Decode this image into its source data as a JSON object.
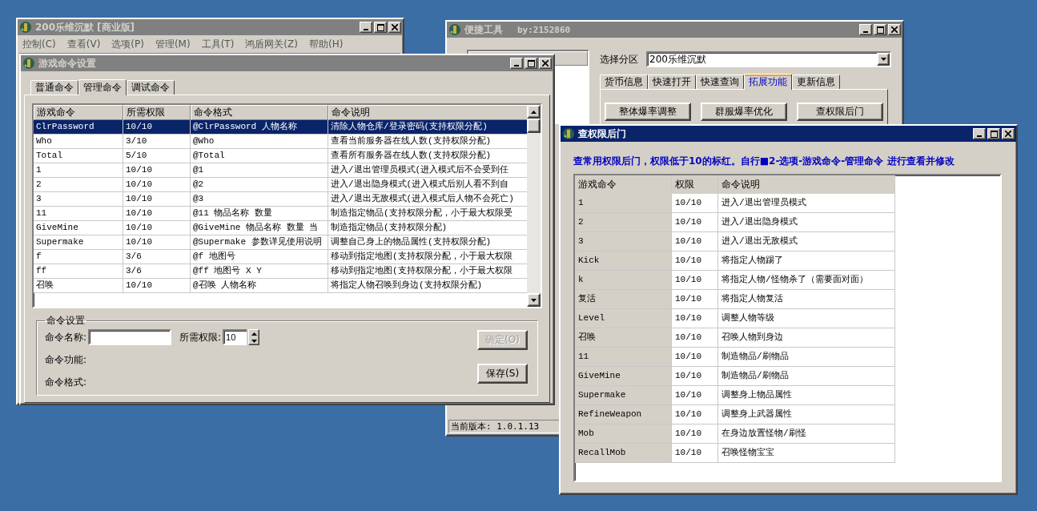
{
  "main_window": {
    "title": "200乐维沉默",
    "edition": "[商业版]",
    "active": false,
    "menu": [
      "控制(C)",
      "查看(V)",
      "选项(P)",
      "管理(M)",
      "工具(T)",
      "鸿盾网关(Z)",
      "帮助(H)"
    ]
  },
  "command_window": {
    "title": "游戏命令设置",
    "active": false,
    "tabs": [
      {
        "label": "普通命令",
        "selected": false
      },
      {
        "label": "管理命令",
        "selected": true
      },
      {
        "label": "调试命令",
        "selected": false
      }
    ],
    "columns": [
      "游戏命令",
      "所需权限",
      "命令格式",
      "命令说明"
    ],
    "rows": [
      {
        "cells": [
          "ClrPassword",
          "10/10",
          "@ClrPassword 人物名称",
          "清除人物仓库/登录密码(支持权限分配)"
        ],
        "selected": true
      },
      {
        "cells": [
          "Who",
          "3/10",
          "@Who",
          "查看当前服务器在线人数(支持权限分配)"
        ],
        "selected": false
      },
      {
        "cells": [
          "Total",
          "5/10",
          "@Total",
          "查看所有服务器在线人数(支持权限分配)"
        ],
        "selected": false
      },
      {
        "cells": [
          "1",
          "10/10",
          "@1",
          "进入/退出管理员模式(进入模式后不会受到任"
        ],
        "selected": false
      },
      {
        "cells": [
          "2",
          "10/10",
          "@2",
          "进入/退出隐身模式(进入模式后别人看不到自"
        ],
        "selected": false
      },
      {
        "cells": [
          "3",
          "10/10",
          "@3",
          "进入/退出无敌模式(进入模式后人物不会死亡)"
        ],
        "selected": false
      },
      {
        "cells": [
          "11",
          "10/10",
          "@11 物品名称 数量",
          "制造指定物品(支持权限分配，小于最大权限受"
        ],
        "selected": false
      },
      {
        "cells": [
          "GiveMine",
          "10/10",
          "@GiveMine 物品名称 数量 当",
          "制造指定物品(支持权限分配)"
        ],
        "selected": false
      },
      {
        "cells": [
          "Supermake",
          "10/10",
          "@Supermake 参数详见使用说明",
          "调整自己身上的物品属性(支持权限分配)"
        ],
        "selected": false
      },
      {
        "cells": [
          "f",
          "3/6",
          "@f 地图号",
          "移动到指定地图(支持权限分配，小于最大权限"
        ],
        "selected": false
      },
      {
        "cells": [
          "ff",
          "3/6",
          "@ff 地图号 X Y",
          "移动到指定地图(支持权限分配，小于最大权限"
        ],
        "selected": false
      },
      {
        "cells": [
          "召唤",
          "10/10",
          "@召唤 人物名称",
          "将指定人物召唤到身边(支持权限分配)"
        ],
        "selected": false
      }
    ],
    "settings": {
      "title": "命令设置",
      "name_label": "命令名称:",
      "permission_label": "所需权限:",
      "permission_value": "10",
      "function_label": "命令功能:",
      "format_label": "命令格式:"
    },
    "buttons": [
      {
        "label": "确定(O)",
        "disabled": true
      },
      {
        "label": "保存(S)",
        "disabled": false
      }
    ]
  },
  "tool_window": {
    "title": "便捷工具",
    "subtitle": "by:2152860",
    "active": false,
    "partition_label": "选择分区",
    "partition_value": "200乐维沉默",
    "tabs": [
      {
        "label": "货币信息",
        "selected": false
      },
      {
        "label": "快速打开",
        "selected": false
      },
      {
        "label": "快速查询",
        "selected": false
      },
      {
        "label": "拓展功能",
        "selected": true
      },
      {
        "label": "更新信息",
        "selected": false
      }
    ],
    "buttons": [
      "整体爆率调整",
      "群服爆率优化",
      "查权限后门"
    ],
    "status": "当前版本: 1.0.1.13"
  },
  "backdoor_window": {
    "title": "查权限后门",
    "active": true,
    "notice": "查常用权限后门，权限低于10的标红。自行■2-选项-游戏命令-管理命令 进行查看并修改",
    "columns": [
      "游戏命令",
      "权限",
      "命令说明"
    ],
    "rows": [
      {
        "cells": [
          "1",
          "10/10",
          "进入/退出管理员模式"
        ]
      },
      {
        "cells": [
          "2",
          "10/10",
          "进入/退出隐身模式"
        ]
      },
      {
        "cells": [
          "3",
          "10/10",
          "进入/退出无敌模式"
        ]
      },
      {
        "cells": [
          "Kick",
          "10/10",
          "将指定人物踢了"
        ]
      },
      {
        "cells": [
          "k",
          "10/10",
          "将指定人物/怪物杀了（需要面对面）"
        ]
      },
      {
        "cells": [
          "复活",
          "10/10",
          "将指定人物复活"
        ]
      },
      {
        "cells": [
          "Level",
          "10/10",
          "调整人物等级"
        ]
      },
      {
        "cells": [
          "召唤",
          "10/10",
          "召唤人物到身边"
        ]
      },
      {
        "cells": [
          "11",
          "10/10",
          "制造物品/刷物品"
        ]
      },
      {
        "cells": [
          "GiveMine",
          "10/10",
          "制造物品/刷物品"
        ]
      },
      {
        "cells": [
          "Supermake",
          "10/10",
          "调整身上物品属性"
        ]
      },
      {
        "cells": [
          "RefineWeapon",
          "10/10",
          "调整身上武器属性"
        ]
      },
      {
        "cells": [
          "Mob",
          "10/10",
          "在身边放置怪物/刷怪"
        ]
      },
      {
        "cells": [
          "RecallMob",
          "10/10",
          "召唤怪物宝宝"
        ]
      }
    ]
  }
}
